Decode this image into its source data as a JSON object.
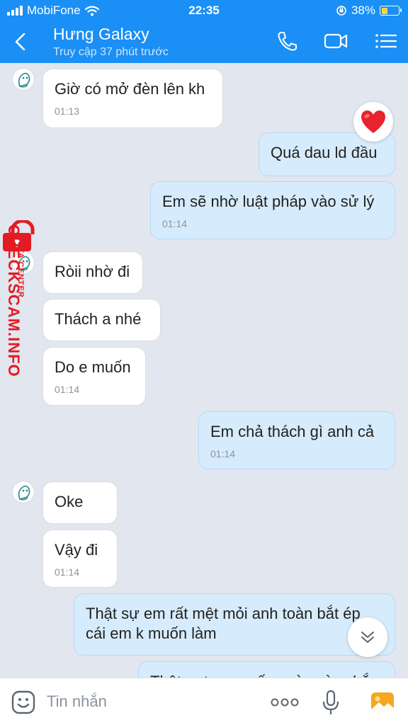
{
  "status_bar": {
    "carrier": "MobiFone",
    "time": "22:35",
    "battery": "38%",
    "battery_level": 0.38
  },
  "header": {
    "title": "Hưng Galaxy",
    "subtitle": "Truy cập 37 phút trước"
  },
  "messages": [
    {
      "dir": "in",
      "text": "Giờ có mở đèn lên kh",
      "time": "01:13"
    },
    {
      "dir": "out",
      "text": "Quá dau ld đầu",
      "time": ""
    },
    {
      "dir": "out",
      "text": "Em sẽ nhờ luật pháp vào sử lý",
      "time": "01:14"
    },
    {
      "dir": "in",
      "text": "Ròii nhờ đi",
      "time": ""
    },
    {
      "dir": "in",
      "text": "Thách a nhé",
      "time": ""
    },
    {
      "dir": "in",
      "text": "Do e muốn",
      "time": "01:14"
    },
    {
      "dir": "out",
      "text": "Em chả thách gì anh cả",
      "time": "01:14"
    },
    {
      "dir": "in",
      "text": "Oke",
      "time": ""
    },
    {
      "dir": "in",
      "text": "Vậy đi",
      "time": "01:14"
    },
    {
      "dir": "out",
      "text": "Thật sự em rất mệt mỏi anh toàn bắt ép cái em k muốn làm",
      "time": ""
    },
    {
      "dir": "out",
      "text": "Thật ra trong mấy ngày này chắc em",
      "time": ""
    }
  ],
  "reaction": {
    "icon": "heart-icon",
    "color": "#e8222e"
  },
  "watermark": {
    "brand": "CHECKSCAM.INFO",
    "sub": "DATA CENTER"
  },
  "composer": {
    "placeholder": "Tin nhắn"
  },
  "colors": {
    "header_bg": "#1a8ff5",
    "chat_bg": "#e2e6ef",
    "bubble_out": "#d6ebfb",
    "bubble_in": "#ffffff",
    "watermark": "#e31b23"
  }
}
